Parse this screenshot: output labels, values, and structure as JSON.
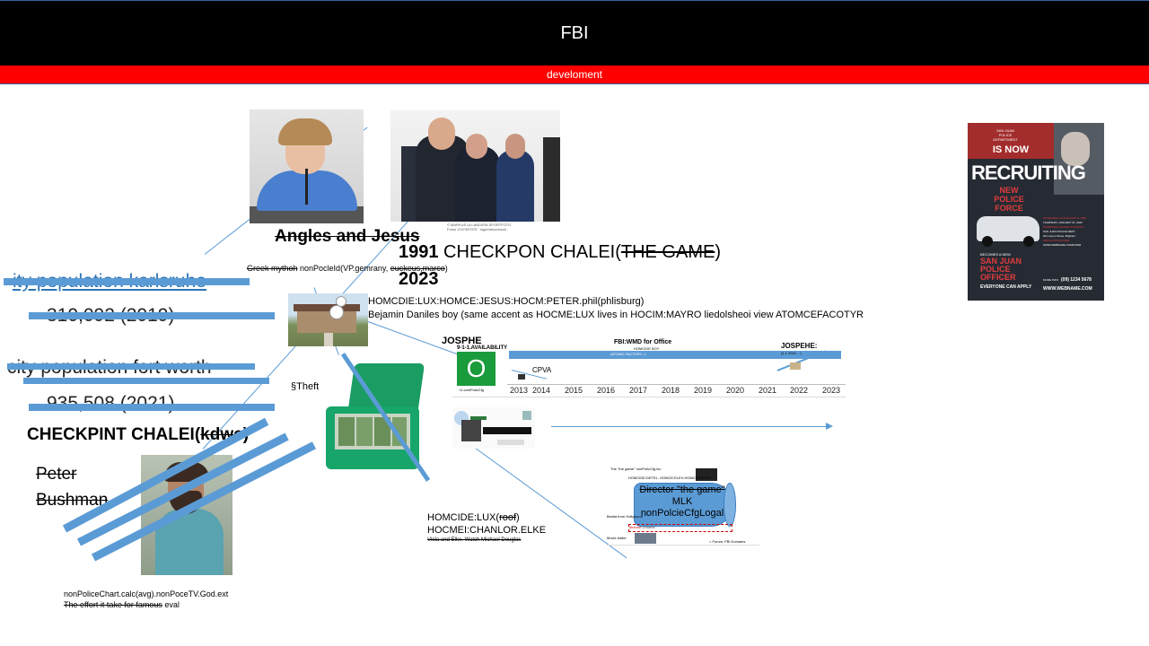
{
  "header": {
    "title": "FBI",
    "subtitle": "develoment"
  },
  "left": {
    "pop1_label": "ity population karlsruhe",
    "pop1_value": "310,092 (2019)",
    "pop2_label": "city population fort worth",
    "pop2_value": "935,508 (2021)",
    "checkpoint_main": "CHECKPINT CHALEI(",
    "checkpoint_struck": "kdwe",
    "checkpoint_close": ")",
    "person_line1": "Peter",
    "person_line2": "Bushman"
  },
  "center": {
    "angles_title": "Angles and Jesus",
    "greek_struck": "Greek mythoh",
    "greek_text": " nonPocleId(VP.gemrany, ",
    "greek_struck2": "euckeus,marco",
    "greek_close": ")",
    "year_1991": "1991",
    "checkpon_text": " CHECKPON CHALEI(",
    "checkpon_struck": "THE GAME",
    "checkpon_close": ")",
    "year_2023": "2023",
    "homicide_line1": "HOMCDIE:LUX:HOMCE:JESUS:HOCM:PETER.phil(phlisburg)",
    "homicide_line2": "Bejamin Daniles boy (same accent as HOCME:LUX lives in HOCIM:MAYRO liedolsheoi view ATOMCEFACOTYR",
    "theft": "§Theft",
    "photo_credit1": "© MARKUS ULLAND/EM-SPORTFOTO",
    "photo_credit2": "Fotos 1247457075 · sigaYahoo/stock"
  },
  "timeline": {
    "header": "FBI:WMD for Office",
    "sub_header": "HOMCIDE BOY",
    "sub_line": "(ATOMC FACTORY...)",
    "josphe": "JOSPHE",
    "availability": "9-1-1.AVAILABILITY",
    "logo_letter": "O",
    "logo_caption": "t1.comPolicCfg",
    "cpva": "CPVA",
    "jospehe": "JOSPEHE:",
    "jospehe_sub": "(1.1 2022 ...)",
    "years": [
      "2013",
      "2014",
      "2015",
      "2016",
      "2017",
      "2018",
      "2019",
      "2020",
      "2021",
      "2022",
      "2023"
    ]
  },
  "lower": {
    "homicide_lux": "HOMCIDE:LUX(",
    "homicide_lux_struck": "roof",
    "homicide_lux_close": ")",
    "chanlor": "HOCMEI:CHANLOR.ELKE",
    "small_struck": "Viola and Elke. Watch Michael Douglas",
    "director_struck": "Director \"the game\"",
    "director_mlk": "MLK",
    "director_cfg": "nonPolcieCfgLogal",
    "mini_title": "The \"the game\" nonPolicCfg.fcc",
    "mini_line": "HOMCIDE:DETEL, HOMCE:ELEX:HOMCE:PETER",
    "mini_left": "Bestia from Hollywood",
    "mini_director": "director",
    "mini_right": "Chrome",
    "mini_bottom_left": "Movie trailer",
    "mini_bottom_right": "= Forum: FBI Domains"
  },
  "footer": {
    "line1": "nonPoliceChart.calc(avg).nonPoceTV.God.ext",
    "line2_struck": "The effort it take for famous",
    "line2_end": " eval"
  },
  "poster": {
    "dept_line1": "SAN JUAN",
    "dept_line2": "POLICE DEPARTMENT",
    "is_now": "IS NOW",
    "recruiting": "RECRUITING",
    "new": "NEW",
    "police": "POLICE",
    "force": "FORCE",
    "interview_title": "INTERVIEW & EXAM DATE & TIME",
    "interview_date": "THURSDAY, JANUARY 21, 9AM",
    "location_title": "INTERVIEW & EXAM LOCATION",
    "location_line1": "SAN JUAN POLICE DEPT.",
    "location_line2": "201 Lorem Street, Brighton",
    "application": "APPLICATION FORM",
    "website_small": "WWW.WEBNAME.COM/FORM",
    "becomes": "BECOMES A NEW",
    "sj1": "SAN JUAN",
    "sj2": "POLICE",
    "sj3": "OFFICER",
    "everyone": "EVERYONE CAN APPLY",
    "more_info": "MORE INFO",
    "phone": "(09) 1234 5678",
    "website": "WWW.WEBNAME.COM"
  }
}
